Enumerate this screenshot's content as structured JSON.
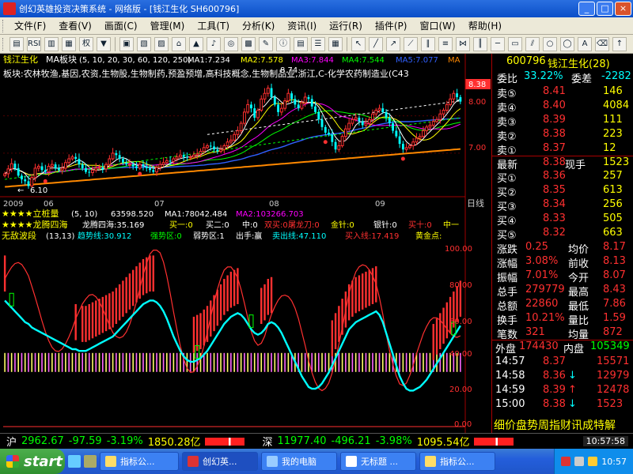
{
  "window": {
    "title": "创幻英雄投资决策系统 - 网络版 - [钱江生化 SH600796]",
    "min": "_",
    "max": "□",
    "close": "×"
  },
  "menu": [
    "文件(F)",
    "查看(V)",
    "画面(C)",
    "管理(M)",
    "工具(T)",
    "分析(K)",
    "资讯(I)",
    "运行(R)",
    "插件(P)",
    "窗口(W)",
    "帮助(H)"
  ],
  "toolbar": {
    "buttons": [
      "RSI",
      "权",
      "▼"
    ]
  },
  "main_chart": {
    "header": {
      "name": "钱江生化",
      "indicator": "MA板块",
      "params": "(5, 10, 20, 30, 60, 120, 250)",
      "ma1": "MA1:7.234",
      "ma2": "MA2:7.578",
      "ma3": "MA3:7.844",
      "ma4": "MA4:7.544",
      "ma5": "MA5:7.077",
      "ma6": "MA"
    },
    "sector": "板块:农林牧渔,基因,农资,生物股,生物制药,预盈预增,高科技概念,生物制品业,浙江,C-化学农药制造业(C43",
    "price_labels": [
      "8.38",
      "8.00",
      "7.00"
    ],
    "low_label": "6.10",
    "high_label": "8.74",
    "dates": [
      "2009",
      "06",
      "07",
      "08",
      "09"
    ],
    "period": "日线"
  },
  "chart_data": [
    {
      "type": "candlestick",
      "x": [
        1,
        2,
        3,
        4,
        5,
        6,
        7,
        8,
        9,
        10,
        11,
        12,
        13,
        14,
        15,
        16,
        17,
        18,
        19,
        20,
        21,
        22,
        23,
        24,
        25,
        26,
        27,
        28,
        29,
        30,
        31,
        32,
        33,
        34,
        35,
        36,
        37,
        38,
        39,
        40,
        41,
        42,
        43,
        44,
        45,
        46,
        47,
        48,
        49,
        50,
        51,
        52,
        53,
        54,
        55,
        56,
        57,
        58,
        59,
        60,
        61,
        62,
        63,
        64,
        65,
        66,
        67,
        68,
        69,
        70,
        71,
        72,
        73,
        74,
        75,
        76,
        77,
        78,
        79,
        80,
        81,
        82,
        83,
        84,
        85,
        86,
        87,
        88,
        89,
        90,
        91,
        92,
        93,
        94,
        95,
        96,
        97,
        98,
        99,
        100,
        101,
        102,
        103,
        104,
        105,
        106,
        107,
        108,
        109,
        110,
        111,
        112,
        113,
        114,
        115,
        116,
        117,
        118,
        119,
        120,
        121,
        122,
        123,
        124,
        125,
        126,
        127,
        128,
        129,
        130,
        131,
        132,
        133,
        134,
        135,
        136
      ],
      "close": [
        6.45,
        6.58,
        6.72,
        6.6,
        6.4,
        6.3,
        6.25,
        6.12,
        6.35,
        6.6,
        6.65,
        6.55,
        6.5,
        6.65,
        6.7,
        6.6,
        6.55,
        6.6,
        6.75,
        6.85,
        6.9,
        6.85,
        6.7,
        6.6,
        6.5,
        6.48,
        6.55,
        6.6,
        6.62,
        6.58,
        6.7,
        6.85,
        7,
        6.95,
        6.85,
        6.75,
        6.7,
        6.7,
        6.65,
        6.6,
        6.7,
        6.65,
        6.6,
        6.55,
        6.5,
        6.62,
        6.7,
        6.75,
        6.8,
        6.78,
        6.85,
        6.9,
        6.95,
        6.9,
        6.88,
        6.9,
        6.95,
        6.98,
        7.05,
        7.15,
        7.2,
        7.18,
        7.1,
        7.05,
        7.1,
        7.2,
        7.3,
        7.35,
        7.5,
        7.6,
        7.8,
        8.1,
        8.3,
        8.2,
        7.95,
        8.15,
        8.45,
        8.6,
        8.74,
        8.5,
        8.3,
        8.1,
        8.2,
        8.4,
        8.6,
        8.45,
        8.3,
        8.2,
        8.35,
        8.5,
        8.45,
        8.25,
        8.1,
        7.9,
        7.7,
        7.55,
        7.5,
        7.3,
        7.1,
        7.2,
        7.45,
        7.65,
        7.8,
        7.9,
        7.95,
        7.85,
        7.75,
        7.8,
        7.9,
        8.05,
        8.15,
        8.2,
        8.1,
        7.95,
        7.8,
        7.6,
        7.45,
        7.25,
        7.1,
        7.15,
        7.2,
        7.3,
        7.4,
        7.45,
        7.6,
        7.7,
        7.75,
        7.85,
        7.9,
        8.05,
        8.15,
        8.3,
        8.45,
        8.6,
        8.5,
        8.38
      ],
      "ylim": [
        5.9,
        8.9
      ]
    },
    {
      "type": "line",
      "title": "无敌波段 (13,13)",
      "series": [
        {
          "name": "趋势线",
          "values": [
            70,
            68,
            66,
            64,
            62,
            60,
            58,
            57,
            55,
            54,
            53,
            52,
            51,
            50,
            49,
            48,
            47,
            46,
            45,
            44,
            43,
            43,
            42,
            42,
            42,
            43,
            44,
            45,
            46,
            47,
            48,
            49,
            50,
            52,
            54,
            56,
            58,
            60,
            62,
            64,
            66,
            68,
            69,
            70,
            70,
            69,
            67,
            64,
            60,
            55,
            50,
            46,
            42,
            39,
            37,
            36,
            36,
            37,
            38,
            40,
            42,
            45,
            48,
            51,
            54,
            57,
            59,
            61,
            62,
            63,
            62,
            60,
            57,
            54,
            52,
            51,
            52,
            54,
            57,
            58,
            57,
            55,
            52,
            48,
            44,
            40,
            36,
            32,
            28,
            25,
            22,
            21,
            21,
            22,
            24,
            27,
            30,
            34,
            38,
            42,
            46,
            50,
            54,
            56,
            58,
            59,
            60,
            61,
            62,
            63,
            64,
            62,
            58,
            52,
            46,
            40,
            34,
            28,
            24,
            21,
            20,
            20,
            21,
            22,
            24,
            26,
            29,
            32,
            35,
            38,
            41,
            44,
            47,
            50,
            53,
            56
          ]
        }
      ],
      "ylim": [
        0,
        100
      ],
      "yticks": [
        100,
        80,
        60,
        40,
        20,
        0
      ]
    }
  ],
  "indicators": {
    "vol_row": {
      "label": "★★★★立桩量",
      "params": "(5, 10)",
      "v": "63598.520",
      "ma1": "MA1:78042.484",
      "ma2": "MA2:103266.703"
    },
    "dragon_row": {
      "label": "★★★★龙腾四海",
      "dragon": "龙腾四海:35.169",
      "buy1": "买一:0",
      "buy2": "买二:0",
      "mid": "中:0",
      "sell": "双买:0",
      "tulong": "屠龙刀:0",
      "jinzhen": "金针:0",
      "yinzhen": "银针:0",
      "buy10": "买十:0",
      "zhong": "中一"
    },
    "wave_row": {
      "label": "无敌波段",
      "params": "(13,13)",
      "trend": "趋势线:30.912",
      "strong": "强势区:0",
      "weak": "弱势区:1",
      "out": "出手:赢",
      "sell_line": "卖出线:47.110",
      "buy_line": "买入线:17.419",
      "gold": "黄金点:"
    },
    "yticks": [
      "100.00",
      "80.00",
      "60.00",
      "40.00",
      "20.00",
      "0.00"
    ]
  },
  "quote": {
    "code": "600796",
    "name": "钱江生化(28)",
    "weibi_label": "委比",
    "weibi": "33.22%",
    "weicha_label": "委差",
    "weicha": "-2282",
    "sell": [
      {
        "label": "卖⑤",
        "price": "8.41",
        "vol": "146"
      },
      {
        "label": "卖④",
        "price": "8.40",
        "vol": "4084"
      },
      {
        "label": "卖③",
        "price": "8.39",
        "vol": "111"
      },
      {
        "label": "卖②",
        "price": "8.38",
        "vol": "223"
      },
      {
        "label": "卖①",
        "price": "8.37",
        "vol": "12"
      }
    ],
    "last_label": "最新",
    "last": "8.38",
    "xianshou_label": "现手",
    "xianshou": "1523",
    "buy": [
      {
        "label": "买①",
        "price": "8.36",
        "vol": "257"
      },
      {
        "label": "买②",
        "price": "8.35",
        "vol": "613"
      },
      {
        "label": "买③",
        "price": "8.34",
        "vol": "256"
      },
      {
        "label": "买④",
        "price": "8.33",
        "vol": "505"
      },
      {
        "label": "买⑤",
        "price": "8.32",
        "vol": "663"
      }
    ],
    "stats": [
      {
        "l1": "涨跌",
        "v1": "0.25",
        "l2": "均价",
        "v2": "8.17"
      },
      {
        "l1": "涨幅",
        "v1": "3.08%",
        "l2": "前收",
        "v2": "8.13"
      },
      {
        "l1": "振幅",
        "v1": "7.01%",
        "l2": "今开",
        "v2": "8.07"
      },
      {
        "l1": "总手",
        "v1": "279779",
        "l2": "最高",
        "v2": "8.43"
      },
      {
        "l1": "总额",
        "v1": "22860",
        "l2": "最低",
        "v2": "7.86"
      },
      {
        "l1": "换手",
        "v1": "10.21%",
        "l2": "量比",
        "v2": "1.59"
      },
      {
        "l1": "笔数",
        "v1": "321",
        "l2": "均量",
        "v2": "872"
      }
    ],
    "waipan_label": "外盘",
    "waipan": "174430",
    "neipan_label": "内盘",
    "neipan": "105349",
    "ticks": [
      {
        "time": "14:57",
        "price": "8.37",
        "vol": "15571",
        "dir": ""
      },
      {
        "time": "14:58",
        "price": "8.36",
        "vol": "12979",
        "dir": "↓"
      },
      {
        "time": "14:59",
        "price": "8.39",
        "vol": "12478",
        "dir": "↑"
      },
      {
        "time": "15:00",
        "price": "8.38",
        "vol": "1523",
        "dir": "↓"
      }
    ],
    "tabs": "细价盘势周指财讯成特解"
  },
  "indexbar": {
    "sh_label": "沪",
    "sh_value": "2962.67",
    "sh_change": "-97.59",
    "sh_pct": "-3.19%",
    "sh_amount": "1850.28亿",
    "sz_label": "深",
    "sz_value": "11977.40",
    "sz_change": "-496.21",
    "sz_pct": "-3.98%",
    "sz_amount": "1095.54亿",
    "time": "10:57:58"
  },
  "taskbar": {
    "start": "start",
    "tasks": [
      "指标公...",
      "创幻英...",
      "我的电脑",
      "无标题 ...",
      "指标公..."
    ],
    "clock": "10:57"
  },
  "colors": {
    "red": "#ff3030",
    "green": "#00ff00",
    "cyan": "#00ffff",
    "yellow": "#ffff00",
    "magenta": "#ff00ff"
  }
}
